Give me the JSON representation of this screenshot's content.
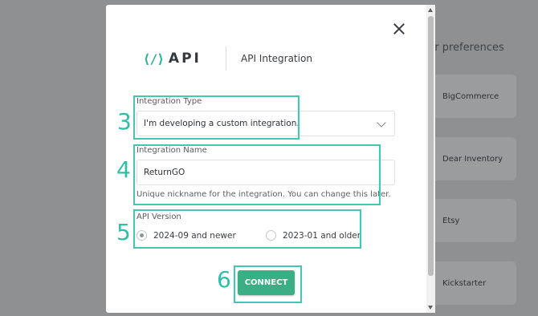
{
  "background": {
    "heading": "ur preferences",
    "cards": [
      "BigCommerce",
      "Dear Inventory",
      "Etsy",
      "Kickstarter"
    ]
  },
  "modal": {
    "logo_glyph": "⟨/⟩",
    "logo_text": "API",
    "title": "API Integration",
    "integration_type": {
      "label": "Integration Type",
      "selected": "I'm developing a custom integration."
    },
    "integration_name": {
      "label": "Integration Name",
      "value": "ReturnGO",
      "hint": "Unique nickname for the integration. You can change this later."
    },
    "api_version": {
      "label": "API Version",
      "options": [
        "2024-09 and newer",
        "2023-01 and older"
      ],
      "selected_index": 0
    },
    "connect_label": "CONNECT"
  },
  "annotations": [
    "3",
    "4",
    "5",
    "6"
  ],
  "colors": {
    "accent": "#3aaf86",
    "highlight": "#3ec9b5",
    "logo": "#2bb3a0"
  }
}
